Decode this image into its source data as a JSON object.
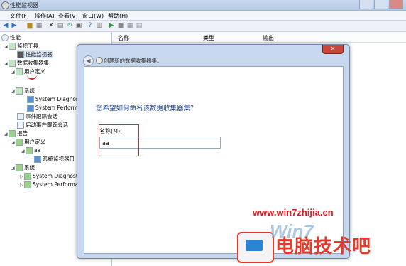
{
  "window": {
    "title": "性能监视器"
  },
  "menu": [
    {
      "label": "文件(F)"
    },
    {
      "label": "操作(A)"
    },
    {
      "label": "查看(V)"
    },
    {
      "label": "窗口(W)"
    },
    {
      "label": "帮助(H)"
    }
  ],
  "tree": {
    "root": "性能",
    "monitor_tools": "监视工具",
    "perf_monitor": "性能监视器",
    "data_collector_sets": "数据收集器集",
    "user_defined": "用户定义",
    "system": "系统",
    "sys_diag": "System Diagnost",
    "sys_perf": "System Performan",
    "event_trace": "事件跟踪会话",
    "startup_trace": "启动事件跟踪会话",
    "reports": "报告",
    "report_user_defined": "用户定义",
    "report_aa": "aa",
    "report_aa_child": "系统监视器日",
    "report_system": "系统",
    "report_sys_diag": "System Diagnost",
    "report_sys_perf": "System Performa"
  },
  "list": {
    "col_name": "名称",
    "col_type": "类型",
    "col_output": "输出"
  },
  "dialog": {
    "header": "创建新的数据收集器集。",
    "question": "您希望如何命名该数据收集器集?",
    "name_label": "名称(M):",
    "name_value": "aa"
  },
  "watermark": {
    "url": "www.win7zhijia.cn",
    "logo": "Win7",
    "brand": "电脑技术吧"
  },
  "colors": {
    "accent_red": "#c8302a",
    "title_bg": "#c9daf0"
  }
}
